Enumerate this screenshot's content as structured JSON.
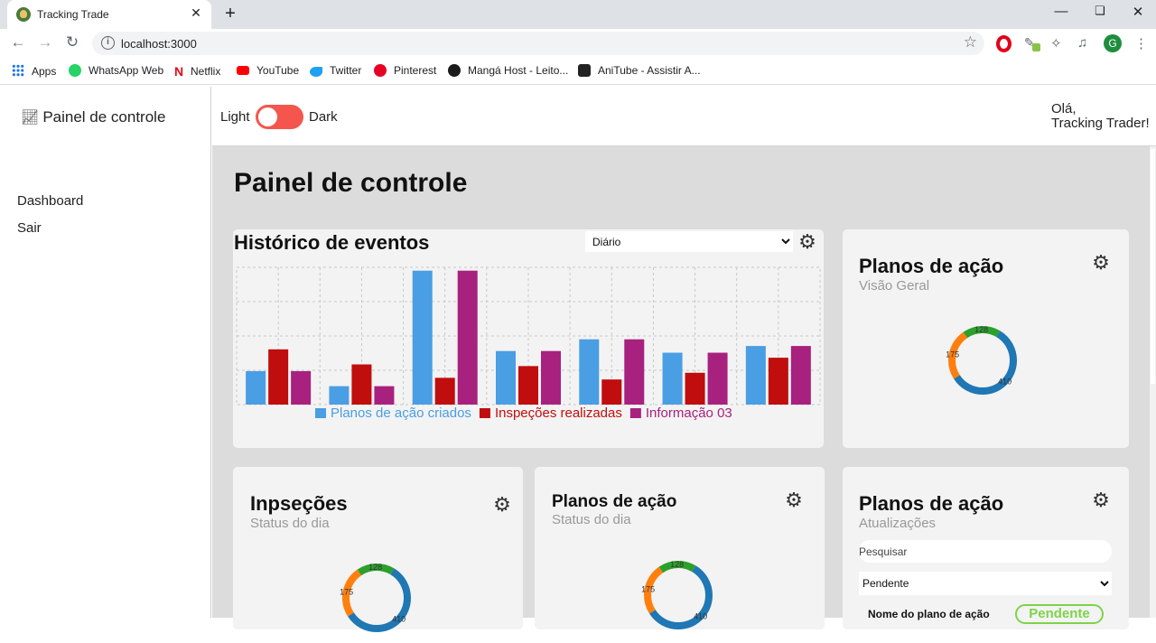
{
  "browser": {
    "tab_title": "Tracking Trade",
    "tab_close": "✕",
    "new_tab": "+",
    "url": "localhost:3000",
    "avatar_initial": "G",
    "bookmarks": [
      {
        "label": "Apps",
        "icon": "apps-grid-icon"
      },
      {
        "label": "WhatsApp Web",
        "icon": "whatsapp-icon",
        "color": "#25d366"
      },
      {
        "label": "Netflix",
        "icon": "netflix-icon",
        "color": "#e50914"
      },
      {
        "label": "YouTube",
        "icon": "youtube-icon",
        "color": "#ff0000"
      },
      {
        "label": "Twitter",
        "icon": "twitter-icon",
        "color": "#1da1f2"
      },
      {
        "label": "Pinterest",
        "icon": "pinterest-icon",
        "color": "#e60023"
      },
      {
        "label": "Mangá Host - Leito...",
        "icon": "mangahost-icon",
        "color": "#1b1b1b"
      },
      {
        "label": "AniTube - Assistir A...",
        "icon": "anitube-icon",
        "color": "#222222"
      }
    ]
  },
  "sidebar": {
    "brand": "Painel de controle",
    "links": [
      "Dashboard",
      "Sair"
    ]
  },
  "header": {
    "theme_light": "Light",
    "theme_dark": "Dark",
    "greeting_line1": "Olá,",
    "greeting_line2": "Tracking Trader!"
  },
  "main": {
    "page_title": "Painel de controle",
    "history_card": {
      "title": "Histórico de eventos",
      "period_selected": "Diário"
    },
    "overview_card": {
      "title": "Planos de ação",
      "subtitle": "Visão Geral"
    },
    "inspections_card": {
      "title": "Inpseções",
      "subtitle": "Status do dia"
    },
    "plans_status_card": {
      "title": "Planos de ação",
      "subtitle": "Status do dia"
    },
    "plans_updates_card": {
      "title": "Planos de ação",
      "subtitle": "Atualizações",
      "search_placeholder": "Pesquisar",
      "status_selected": "Pendente",
      "plan_name_label": "Nome do plano de ação",
      "badge": "Pendente"
    }
  },
  "colors": {
    "accent_red": "#f4564d",
    "series_blue": "#4a9ee3",
    "series_red": "#c00d0d",
    "series_purple": "#a8217e",
    "donut_blue": "#1f77b4",
    "donut_orange": "#ff7f0e",
    "donut_green": "#2ca02c",
    "badge_green": "#7ed348"
  },
  "chart_data": [
    {
      "type": "bar",
      "categories": [
        "",
        "",
        "",
        "",
        "",
        "",
        ""
      ],
      "series": [
        {
          "name": "Planos de ação criados",
          "color": "#4a9ee3",
          "values": [
            2.0,
            1.1,
            8.0,
            3.2,
            3.9,
            3.1,
            3.5
          ]
        },
        {
          "name": "Inspeções realizadas",
          "color": "#c00d0d",
          "values": [
            3.3,
            2.4,
            1.6,
            2.3,
            1.5,
            1.9,
            2.8
          ]
        },
        {
          "name": "Informação 03",
          "color": "#a8217e",
          "values": [
            2.0,
            1.1,
            8.0,
            3.2,
            3.9,
            3.1,
            3.5
          ]
        }
      ],
      "ylim": [
        0,
        8.2
      ],
      "grid": true,
      "legend": "bottom"
    },
    {
      "type": "pie",
      "labels": [
        "410",
        "175",
        "128"
      ],
      "values": [
        410,
        175,
        128
      ],
      "colors": [
        "#1f77b4",
        "#ff7f0e",
        "#2ca02c"
      ]
    }
  ]
}
